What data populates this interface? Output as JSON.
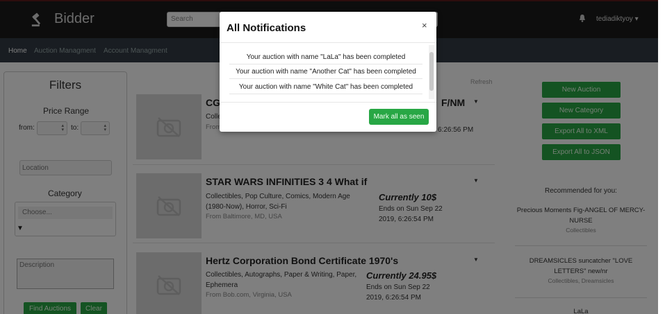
{
  "navbar": {
    "brand": "Bidder",
    "search_placeholder": "Search",
    "username": "tediadiktyoy ▾"
  },
  "subnav": {
    "items": [
      "Home",
      "Auction Managment",
      "Account Managment"
    ]
  },
  "filters": {
    "title": "Filters",
    "price_range_label": "Price Range",
    "from_label": "from:",
    "to_label": "to:",
    "location_placeholder": "Location",
    "category_label": "Category",
    "category_option": "Choose...",
    "description_placeholder": "Description",
    "find_button": "Find Auctions",
    "clear_button": "Clear"
  },
  "list": {
    "refresh_label": "Refresh",
    "auctions": [
      {
        "title_start": "CG",
        "title_end": "F/NM",
        "cats": "Collecti",
        "from": "From",
        "ends_time": "6:26:56 PM"
      },
      {
        "title": "STAR WARS INFINITIES 3 4 What if",
        "cats": "Collectibles, Pop Culture, Comics, Modern Age (1980-Now), Horror, Sci-Fi",
        "from": "From Baltimore, MD, USA",
        "price": "Currently 10$",
        "ends": "Ends on Sun Sep 22 2019, 6:26:54 PM"
      },
      {
        "title": "Hertz Corporation Bond Certificate 1970's",
        "cats": "Collectibles, Autographs, Paper & Writing, Paper, Ephemera",
        "from": "From Bob.com, Virginia, USA",
        "price": "Currently 24.95$",
        "ends": "Ends on Sun Sep 22 2019, 6:26:54 PM"
      }
    ]
  },
  "sidebar": {
    "buttons": [
      "New Auction",
      "New Category",
      "Export All to XML",
      "Export All to JSON"
    ],
    "recommended_title": "Recommended for you:",
    "recommended": [
      {
        "name": "Precious Moments Fig-ANGEL OF MERCY- NURSE",
        "category": "Collectibles"
      },
      {
        "name": "DREAMSICLES suncatcher \"LOVE LETTERS\" new/nr",
        "category": "Collectibles, Dreamsicles"
      },
      {
        "name": "LaLa",
        "category": ""
      }
    ]
  },
  "modal": {
    "title": "All Notifications",
    "close": "×",
    "notifications": [
      "Your auction with name \"LaLa\" has been completed",
      "Your auction with name \"Another Cat\" has been completed",
      "Your auction with name \"White Cat\" has been completed"
    ],
    "mark_all_button": "Mark all as seen"
  },
  "colors": {
    "navbar_bg": "#1a1a1a",
    "subnav_bg": "#333a45",
    "accent_green": "#28a745",
    "overlay": "rgba(0,0,0,0.5)"
  },
  "icons": [
    "gavel-icon",
    "bell-icon",
    "no-image-icon",
    "caret-down-icon",
    "close-icon"
  ]
}
